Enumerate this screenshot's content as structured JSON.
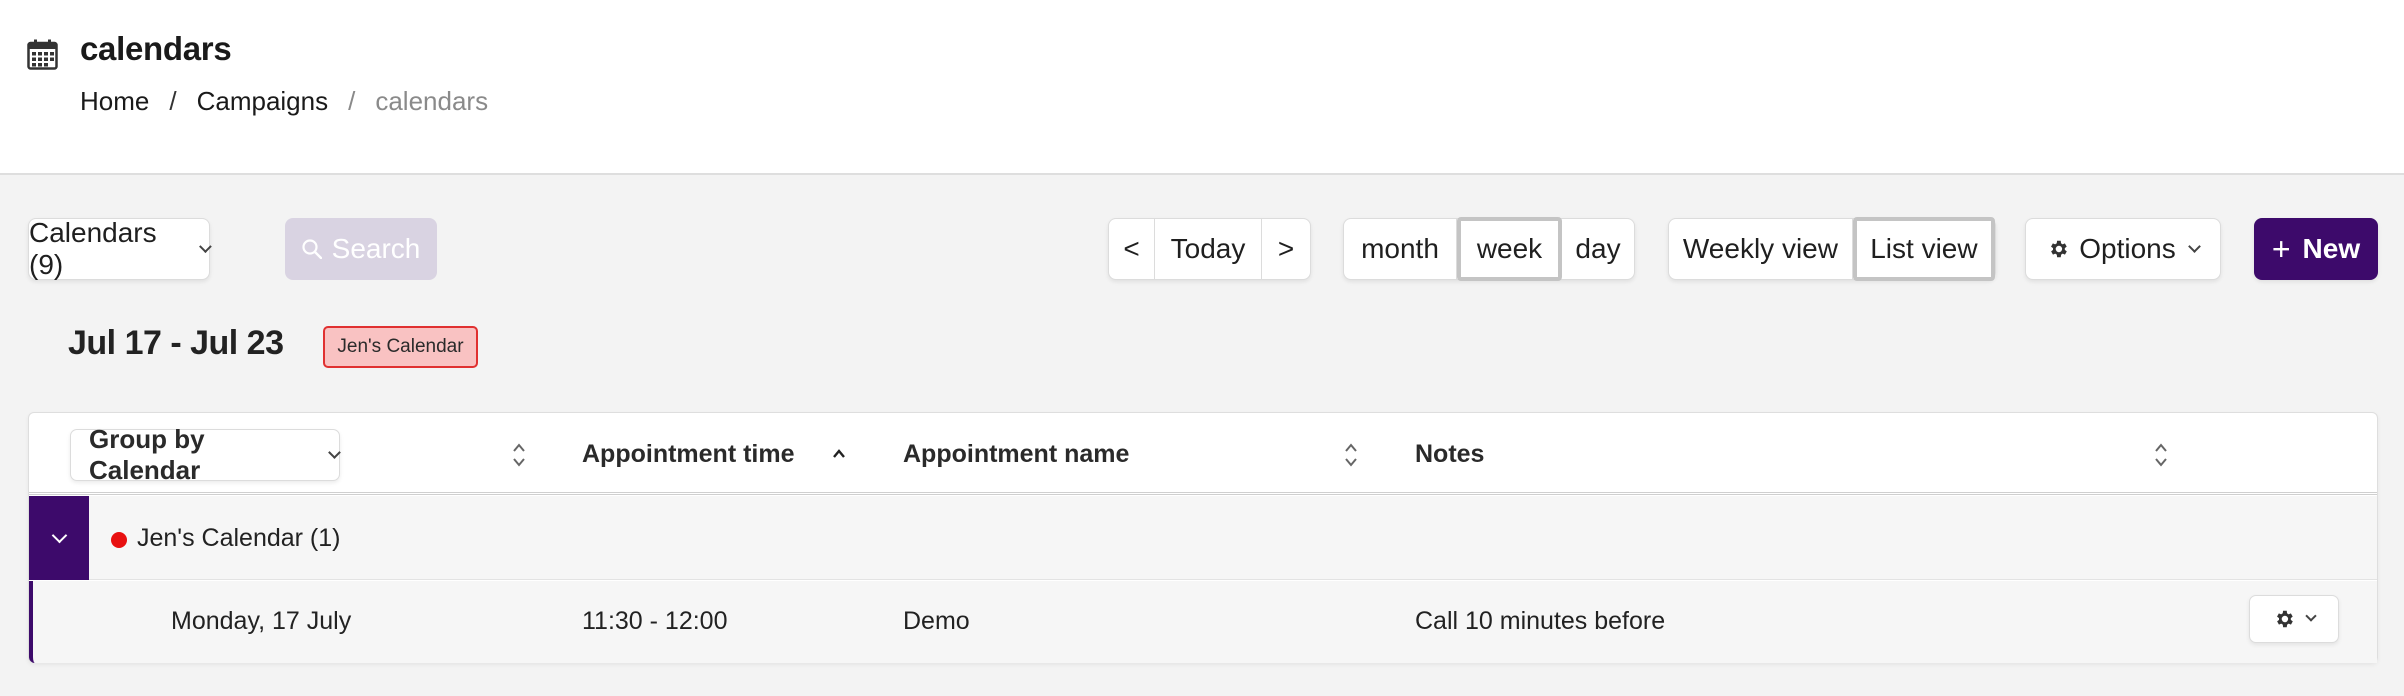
{
  "header": {
    "title": "calendars",
    "breadcrumb": {
      "home": "Home",
      "sep1": "/",
      "campaigns": "Campaigns",
      "sep2": "/",
      "current": "calendars"
    }
  },
  "toolbar": {
    "calendars_label": "Calendars (9)",
    "search_label": "Search",
    "prev_label": "<",
    "today_label": "Today",
    "next_label": ">",
    "views": {
      "month": "month",
      "week": "week",
      "day": "day",
      "active": "week"
    },
    "modes": {
      "weekly": "Weekly view",
      "list": "List view",
      "active": "List view"
    },
    "options_label": "Options",
    "new_label": "New",
    "colors": {
      "primary": "#3d0a6b",
      "search_disabled": "#d9d3e2"
    }
  },
  "range": {
    "label": "Jul 17 - Jul 23",
    "calendar_tag": "Jen's Calendar",
    "tag_colors": {
      "fill": "#f9c2c2",
      "border": "#e03030"
    }
  },
  "table": {
    "group_by_label": "Group by Calendar",
    "columns": [
      "Appointment time",
      "Appointment name",
      "Notes"
    ],
    "groups": [
      {
        "label": "Jen's Calendar (1)",
        "dot_color": "#e81010",
        "rows": [
          {
            "date": "Monday, 17 July",
            "time": "11:30 - 12:00",
            "name": "Demo",
            "notes": "Call 10 minutes before"
          }
        ]
      }
    ]
  }
}
